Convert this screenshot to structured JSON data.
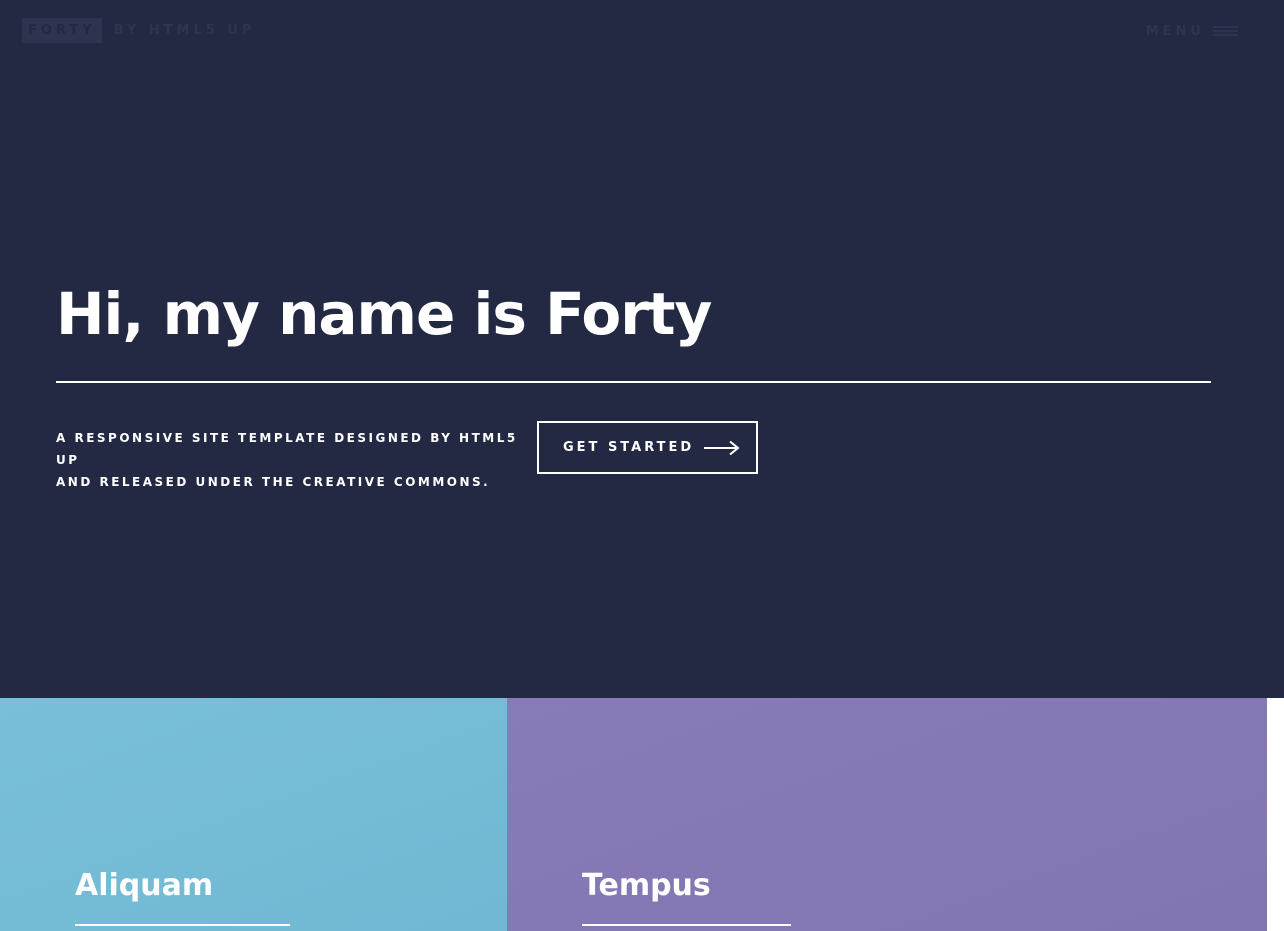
{
  "header": {
    "logo_text": "FORTY",
    "logo_by": "BY HTML5 UP",
    "menu_label": "MENU",
    "menu_icon": "hamburger-icon"
  },
  "banner": {
    "title": "Hi, my name is Forty",
    "text_line1": "A RESPONSIVE SITE TEMPLATE DESIGNED BY HTML5 UP",
    "text_line2": "AND RELEASED UNDER THE CREATIVE COMMONS.",
    "button_label": "GET STARTED",
    "button_icon": "arrow-right-icon"
  },
  "tiles": [
    {
      "title": "Aliquam",
      "color": "#75bcd6"
    },
    {
      "title": "Tempus",
      "color": "#8479b5"
    }
  ],
  "colors": {
    "background": "#242943",
    "header_text": "#2e3450",
    "text": "#ffffff"
  }
}
